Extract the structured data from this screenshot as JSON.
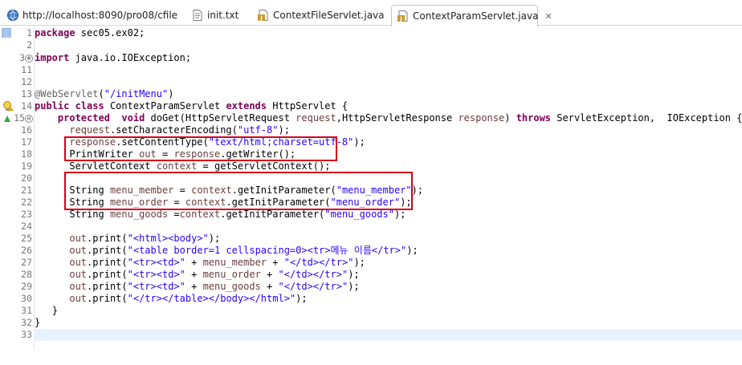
{
  "tabs": [
    {
      "label": "http://localhost:8090/pro08/cfile",
      "icon": "browser-globe-icon",
      "active": false
    },
    {
      "label": "init.txt",
      "icon": "text-file-icon",
      "active": false
    },
    {
      "label": "ContextFileServlet.java",
      "icon": "java-file-icon",
      "active": false
    },
    {
      "label": "ContextParamServlet.java",
      "icon": "java-file-icon",
      "active": true,
      "close": "✕"
    }
  ],
  "editor": {
    "line_numbers": [
      "1",
      "2",
      "3",
      "11",
      "12",
      "13",
      "14",
      "15",
      "16",
      "17",
      "18",
      "19",
      "20",
      "21",
      "22",
      "23",
      "24",
      "25",
      "26",
      "27",
      "28",
      "29",
      "30",
      "31",
      "32",
      "33"
    ],
    "fold_collapsed": "⊕",
    "fold_expanded": "⊖",
    "code": {
      "l1": {
        "kw": "package",
        "rest": " sec05.ex02;"
      },
      "l3": {
        "kw": "import",
        "rest": " java.io.IOException;"
      },
      "l13": {
        "ann": "@WebServlet",
        "p": "(",
        "str": "\"/initMenu\"",
        "end": ")"
      },
      "l14": {
        "kw1": "public",
        "kw2": "class",
        "cls": " ContextParamServlet ",
        "kw3": "extends",
        "rest": " HttpServlet {"
      },
      "l15": {
        "kw1": "protected",
        "kw2": "void",
        "a": " doGet(HttpServletRequest ",
        "v1": "request",
        "b": ",HttpServletResponse ",
        "v2": "response",
        "c": ") ",
        "kw3": "throws",
        "d": " ServletException,  IOException {"
      },
      "l16": {
        "v": "request",
        "a": ".setCharacterEncoding(",
        "s": "\"utf-8\"",
        "e": ");"
      },
      "l17": {
        "v": "response",
        "a": ".setContentType(",
        "s": "\"text/html;charset=utf-8\"",
        "e": ");"
      },
      "l18": {
        "a": "PrintWriter ",
        "v": "out",
        "b": " = ",
        "v2": "response",
        "c": ".getWriter();"
      },
      "l19": {
        "a": "ServletContext ",
        "v": "context",
        "b": " = getServletContext();"
      },
      "l21": {
        "a": "String ",
        "v": "menu_member",
        "b": " = ",
        "v2": "context",
        "c": ".getInitParameter(",
        "s": "\"menu_member\"",
        "e": ");"
      },
      "l22": {
        "a": "String ",
        "v": "menu_order",
        "b": " = ",
        "v2": "context",
        "c": ".getInitParameter(",
        "s": "\"menu_order\"",
        "e": ");"
      },
      "l23": {
        "a": "String ",
        "v": "menu_goods",
        "b": " =",
        "v2": "context",
        "c": ".getInitParameter(",
        "s": "\"menu_goods\"",
        "e": ");"
      },
      "l25": {
        "v": "out",
        "a": ".print(",
        "s": "\"<html><body>\"",
        "e": ");"
      },
      "l26": {
        "v": "out",
        "a": ".print(",
        "s": "\"<table border=1 cellspacing=0><tr>메뉴 이름</tr>\"",
        "e": ");"
      },
      "l27": {
        "v": "out",
        "a": ".print(",
        "s": "\"<tr><td>\"",
        "b": " + ",
        "v2": "menu_member",
        "c": " + ",
        "s2": "\"</td></tr>\"",
        "e": ");"
      },
      "l28": {
        "v": "out",
        "a": ".print(",
        "s": "\"<tr><td>\"",
        "b": " + ",
        "v2": "menu_order",
        "c": " + ",
        "s2": "\"</td></tr>\"",
        "e": ");"
      },
      "l29": {
        "v": "out",
        "a": ".print(",
        "s": "\"<tr><td>\"",
        "b": " + ",
        "v2": "menu_goods",
        "c": " + ",
        "s2": "\"</td></tr>\"",
        "e": ");"
      },
      "l30": {
        "v": "out",
        "a": ".print(",
        "s": "\"</tr></table></body></html>\"",
        "e": ");"
      },
      "l31": "}",
      "l32": "}"
    }
  },
  "colors": {
    "keyword": "#7f0055",
    "string": "#2a00ff",
    "variable": "#6a3e3e",
    "annotation": "#646464",
    "highlight_box": "#d6001c",
    "current_line": "#e8f2fe"
  }
}
